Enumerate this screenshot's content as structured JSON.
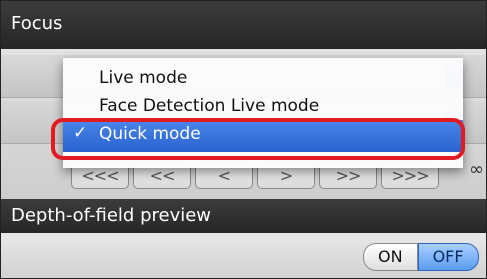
{
  "focus": {
    "header_title": "Focus",
    "drive_buttons": [
      "<<<",
      "<<",
      "<",
      ">",
      ">>",
      ">>>"
    ],
    "infinity_symbol": "∞"
  },
  "focus_mode_menu": {
    "items": [
      {
        "label": "Live mode",
        "checked": false
      },
      {
        "label": "Face Detection Live mode",
        "checked": false
      },
      {
        "label": "Quick mode",
        "checked": true
      }
    ],
    "check_mark": "✓",
    "selected_color": "#2f6cd6",
    "highlight_color": "#e21b22"
  },
  "depth_of_field": {
    "header_title": "Depth-of-field preview",
    "on_label": "ON",
    "off_label": "OFF",
    "active": "OFF",
    "active_color": "#5a9cf0"
  }
}
